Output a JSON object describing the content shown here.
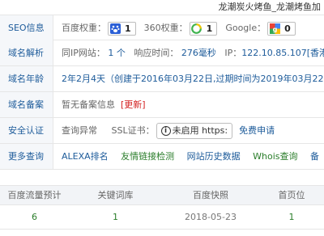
{
  "site_title": "龙潮炭火烤鱼_龙潮烤鱼加",
  "rows": {
    "seo": {
      "label": "SEO信息",
      "baidu_label": "百度权重：",
      "baidu_value": "1",
      "so360_label": "360权重：",
      "so360_value": "1",
      "google_label": "Google：",
      "google_value": "0"
    },
    "dns": {
      "label": "域名解析",
      "same_ip_label": "同IP网站：",
      "same_ip_value": "1 个",
      "response_label": "响应时间：",
      "response_value": "276毫秒",
      "ip_label": "IP：",
      "ip_value": "122.10.85.107[香港]"
    },
    "age": {
      "label": "域名年龄",
      "value": "2年2月4天（创建于2016年03月22日,过期时间为2019年03月22日）"
    },
    "icp": {
      "label": "域名备案",
      "value": "暂无备案信息",
      "refresh": "[更新]"
    },
    "security": {
      "label": "安全认证",
      "check_label": "查询异常",
      "ssl_label": "SSL证书：",
      "ssl_status": "未启用 https:",
      "apply": "免费申请"
    },
    "more": {
      "label": "更多查询",
      "items": [
        "ALEXA排名",
        "友情链接检测",
        "网站历史数据",
        "Whois查询",
        "备"
      ]
    }
  },
  "stats": {
    "headers": [
      "百度流量预计",
      "关键词库",
      "百度快照",
      "首页位"
    ],
    "values": [
      "6",
      "1",
      "2018-05-23",
      "1"
    ]
  },
  "colors": {
    "label_blue": "#1d5b9a",
    "green": "#2a7d2a",
    "red": "#d42020",
    "label_bg": "#f5f7fa"
  }
}
